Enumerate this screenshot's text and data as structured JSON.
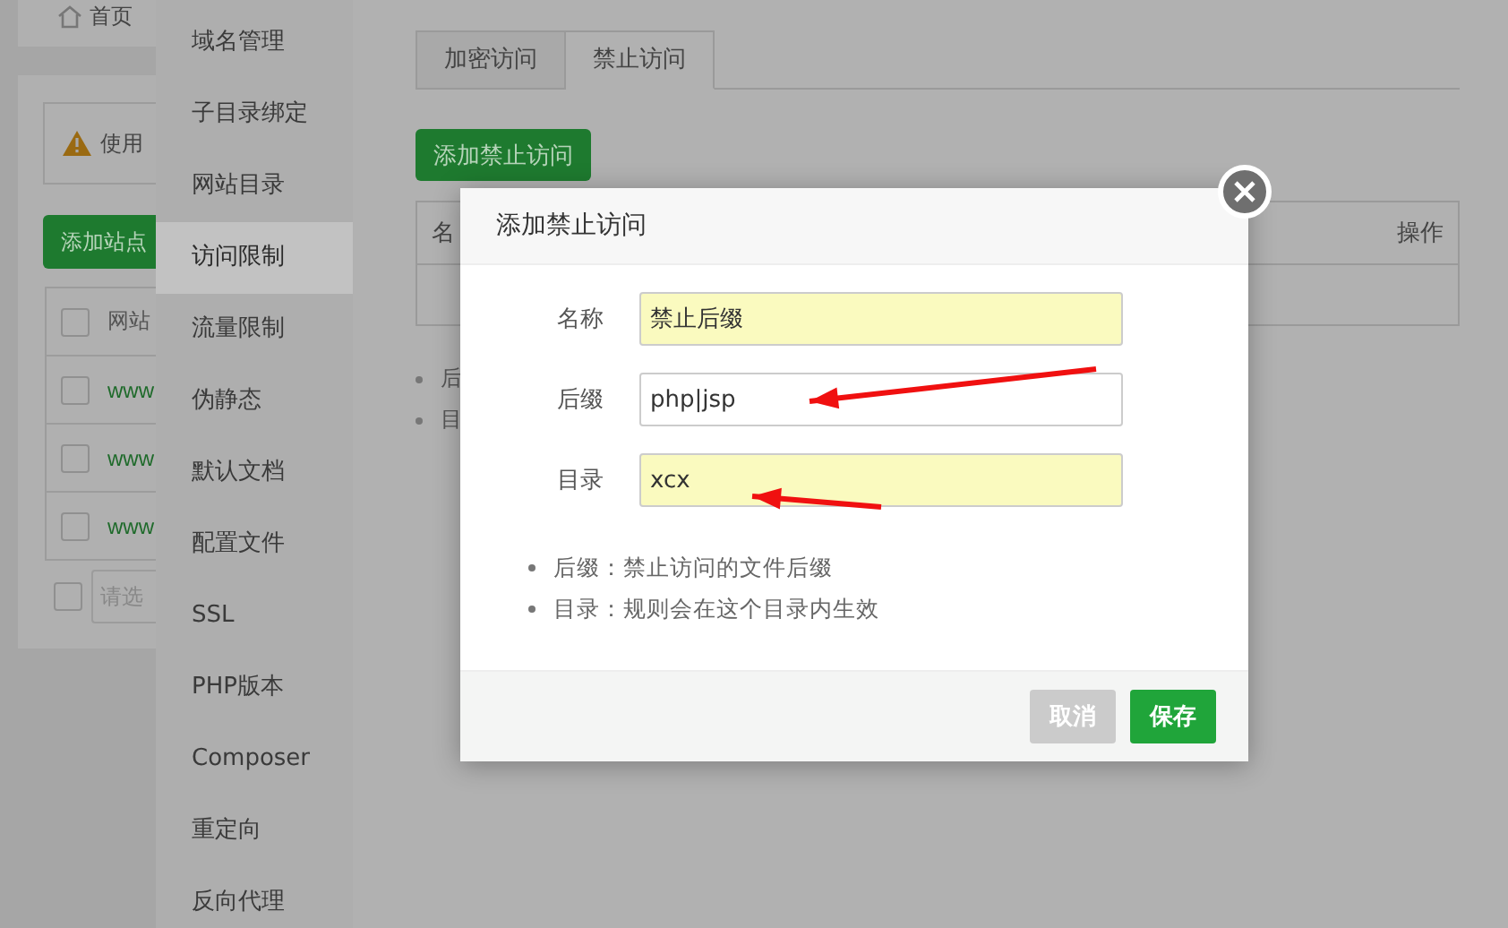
{
  "background_page": {
    "home_label": "首页",
    "warning": "使用",
    "add_site_button": "添加站点",
    "table": {
      "header": "网站",
      "header_checked": false,
      "rows": [
        {
          "site": "www",
          "checked": false
        },
        {
          "site": "www",
          "checked": false
        },
        {
          "site": "www",
          "checked": false
        }
      ]
    },
    "footer_checked": false,
    "batch_placeholder": "请选"
  },
  "side_menu": {
    "items": [
      {
        "label": "域名管理",
        "selected": false
      },
      {
        "label": "子目录绑定",
        "selected": false
      },
      {
        "label": "网站目录",
        "selected": false
      },
      {
        "label": "访问限制",
        "selected": true
      },
      {
        "label": "流量限制",
        "selected": false
      },
      {
        "label": "伪静态",
        "selected": false
      },
      {
        "label": "默认文档",
        "selected": false
      },
      {
        "label": "配置文件",
        "selected": false
      },
      {
        "label": "SSL",
        "selected": false
      },
      {
        "label": "PHP版本",
        "selected": false
      },
      {
        "label": "Composer",
        "selected": false
      },
      {
        "label": "重定向",
        "selected": false
      },
      {
        "label": "反向代理",
        "selected": false
      }
    ]
  },
  "main": {
    "tabs": [
      {
        "label": "加密访问",
        "selected": false
      },
      {
        "label": "禁止访问",
        "selected": true
      }
    ],
    "add_button": "添加禁止访问",
    "table": {
      "columns": [
        "名",
        "操作"
      ]
    },
    "notes": [
      "后",
      "目"
    ]
  },
  "dialog": {
    "title": "添加禁止访问",
    "fields": [
      {
        "label": "名称",
        "value": "禁止后缀",
        "autofilled": true
      },
      {
        "label": "后缀",
        "value": "php|jsp",
        "autofilled": false
      },
      {
        "label": "目录",
        "value": "xcx",
        "autofilled": true
      }
    ],
    "notes": [
      "后缀：禁止访问的文件后缀",
      "目录：规则会在这个目录内生效"
    ],
    "buttons": [
      {
        "label": "取消",
        "disabled": true
      },
      {
        "label": "保存",
        "disabled": false
      }
    ]
  },
  "annotations": [
    {
      "kind": "arrow"
    },
    {
      "kind": "arrow"
    }
  ]
}
